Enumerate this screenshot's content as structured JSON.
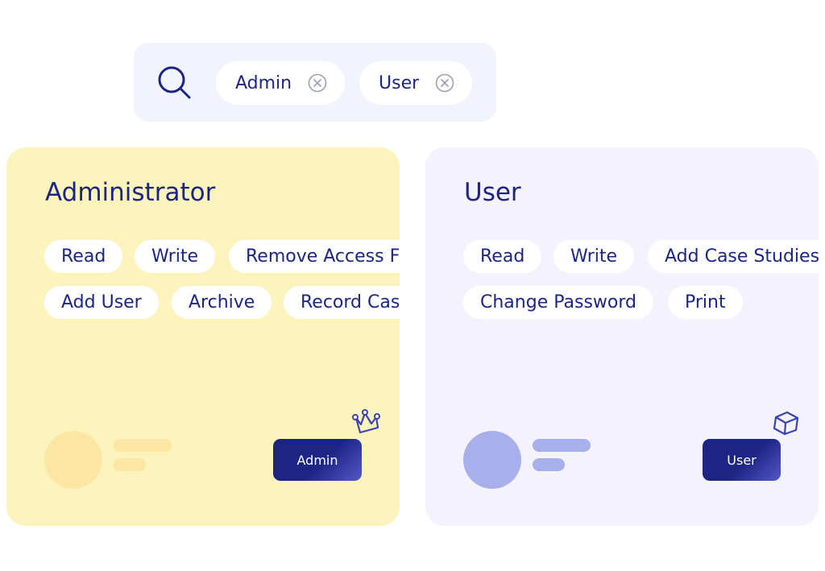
{
  "search": {
    "filters": [
      {
        "label": "Admin"
      },
      {
        "label": "User"
      }
    ]
  },
  "cards": {
    "admin": {
      "title": "Administrator",
      "permissions": [
        "Read",
        "Write",
        "Remove Access From",
        "Add User",
        "Archive",
        "Record Case"
      ],
      "button_label": "Admin",
      "icon": "crown-icon"
    },
    "user": {
      "title": "User",
      "permissions": [
        "Read",
        "Write",
        "Add Case Studies",
        "Change Password",
        "Print"
      ],
      "button_label": "User",
      "icon": "cube-icon"
    }
  },
  "colors": {
    "primary": "#1c2583",
    "admin_card_bg": "#fdf3bd",
    "user_card_bg": "#f3f2fd",
    "search_bg": "#f1f4fd",
    "admin_placeholder": "#fce6a3",
    "user_placeholder": "#a8b0ec"
  }
}
